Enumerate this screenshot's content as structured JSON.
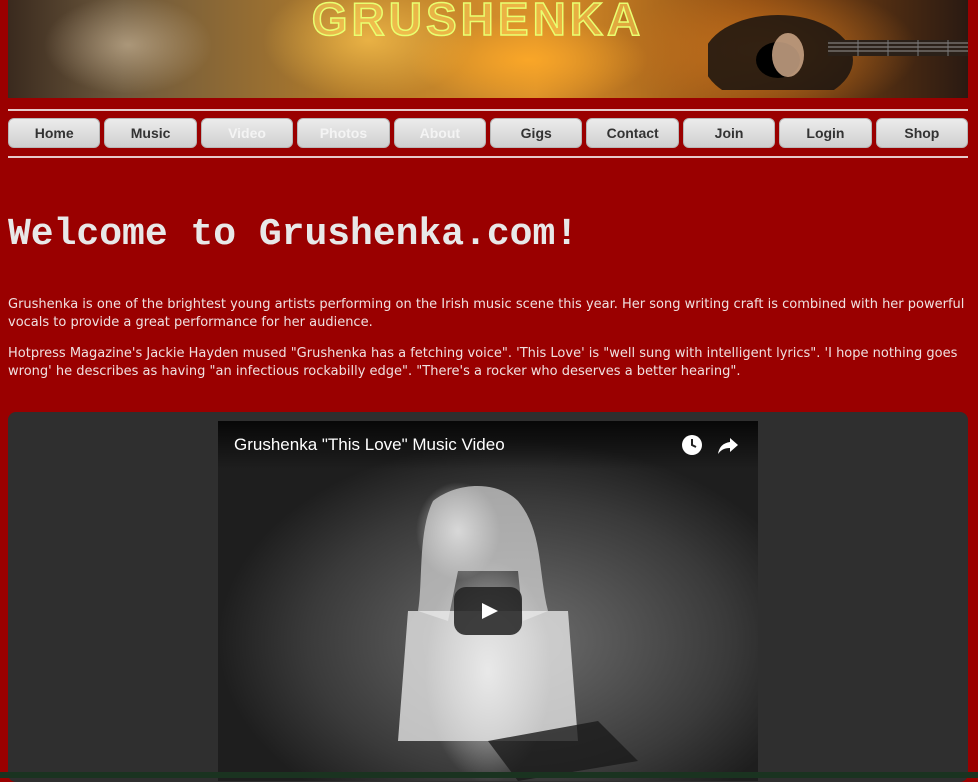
{
  "banner": {
    "title": "GRUSHENKA"
  },
  "nav": {
    "items": [
      {
        "label": "Home"
      },
      {
        "label": "Music"
      },
      {
        "label": "Video"
      },
      {
        "label": "Photos"
      },
      {
        "label": "About"
      },
      {
        "label": "Gigs"
      },
      {
        "label": "Contact"
      },
      {
        "label": "Join"
      },
      {
        "label": "Login"
      },
      {
        "label": "Shop"
      }
    ]
  },
  "main": {
    "heading": "Welcome to Grushenka.com!",
    "intro": "Grushenka is one of the brightest young artists performing on the Irish music scene this year. Her song writing craft is combined with her powerful vocals to provide a great performance for her audience.",
    "review": "Hotpress Magazine's Jackie Hayden mused \"Grushenka has a fetching voice\". 'This Love' is \"well sung with intelligent lyrics\". 'I hope nothing goes wrong' he describes as having \"an infectious rockabilly edge\". \"There's a rocker who deserves a better hearing\"."
  },
  "video": {
    "title": "Grushenka \"This Love\" Music Video",
    "icons": [
      "clock-icon",
      "share-icon",
      "play-icon"
    ]
  },
  "colors": {
    "background": "#9a0000",
    "panel": "#2f2f2f",
    "button": "#dddddd"
  }
}
